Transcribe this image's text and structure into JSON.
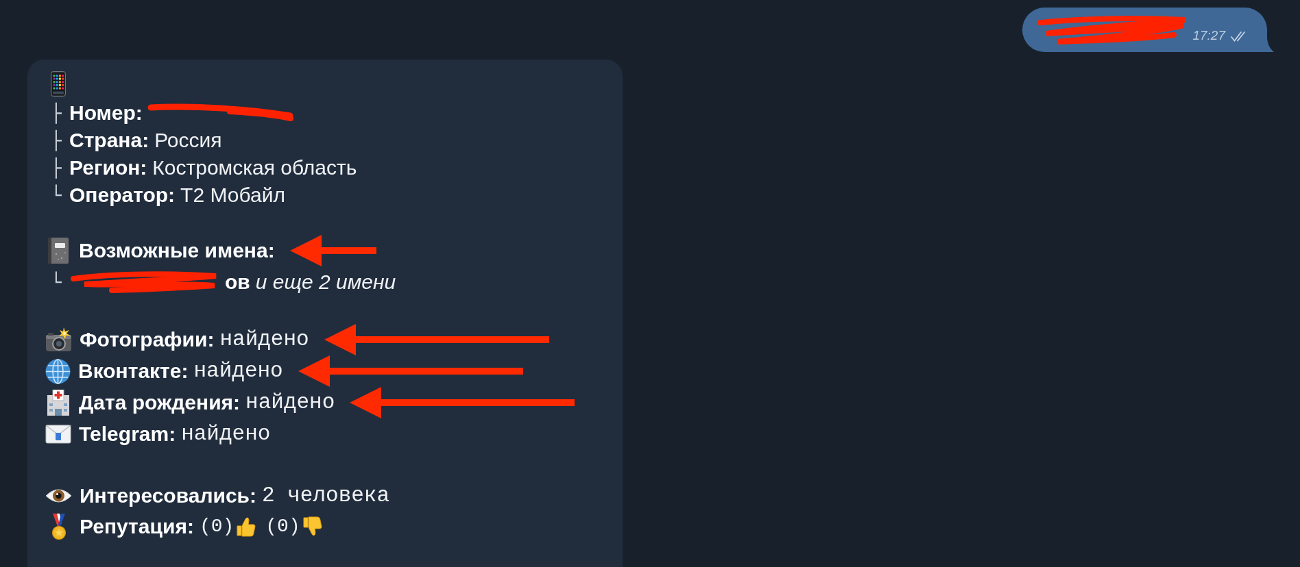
{
  "outgoing_message": {
    "text_redacted": true,
    "time": "17:27",
    "read": true
  },
  "report": {
    "phone_section": {
      "fields": [
        {
          "branch": "├",
          "label": "Номер:",
          "redacted": true
        },
        {
          "branch": "├",
          "label": "Страна:",
          "value": "Россия"
        },
        {
          "branch": "├",
          "label": "Регион:",
          "value": "Костромская область"
        },
        {
          "branch": "└",
          "label": "Оператор:",
          "value": "Т2 Мобайл"
        }
      ]
    },
    "names_section": {
      "label": "Возможные имена:",
      "arrow": true,
      "items": [
        {
          "branch": "└",
          "redacted": true,
          "name": "ов",
          "more": "и еще 2 имени"
        }
      ]
    },
    "sources": [
      {
        "kind": "photos",
        "label": "Фотографии:",
        "value": "найдено",
        "arrow": true
      },
      {
        "kind": "social",
        "label": "Вконтакте:",
        "value": "найдено",
        "arrow": true
      },
      {
        "kind": "birthday",
        "label": "Дата рождения:",
        "value": "найдено",
        "arrow": true
      },
      {
        "kind": "messenger",
        "label": "Telegram:",
        "value": "найдено",
        "arrow": false
      }
    ],
    "views": {
      "label": "Интересовались:",
      "value": "2 человека"
    },
    "reputation": {
      "label": "Репутация:",
      "likes": "(0)",
      "dislikes": "(0)"
    }
  }
}
